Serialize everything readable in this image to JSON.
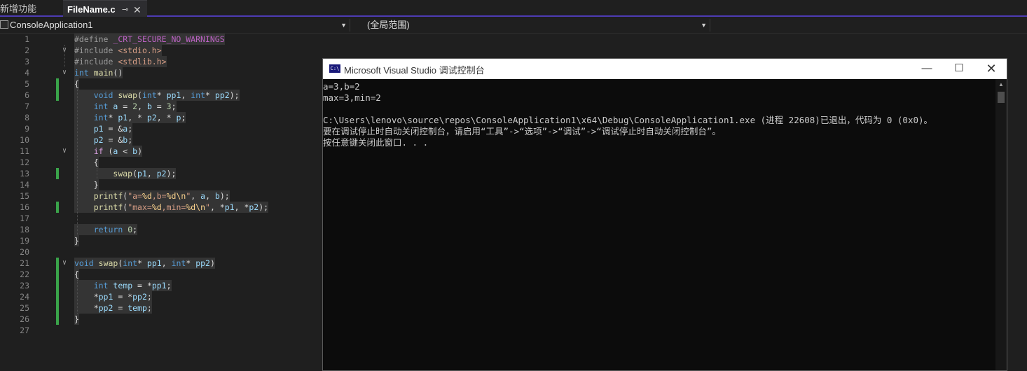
{
  "tabs": [
    {
      "label": "新增功能"
    },
    {
      "label": "FileName.c",
      "pin": "⊸",
      "close": "✕"
    }
  ],
  "navbar": {
    "project": "ConsoleApplication1",
    "scope": "(全局范围)"
  },
  "editor": {
    "line_numbers": [
      "1",
      "2",
      "3",
      "4",
      "5",
      "6",
      "7",
      "8",
      "9",
      "10",
      "11",
      "12",
      "13",
      "14",
      "15",
      "16",
      "17",
      "18",
      "19",
      "20",
      "21",
      "22",
      "23",
      "24",
      "25",
      "26",
      "27"
    ],
    "code": [
      "#define _CRT_SECURE_NO_WARNINGS",
      "#include <stdio.h>",
      "#include <stdlib.h>",
      "int main()",
      "{",
      "    void swap(int* pp1, int* pp2);",
      "    int a = 2, b = 3;",
      "    int* p1, * p2, * p;",
      "    p1 = &a;",
      "    p2 = &b;",
      "    if (a < b)",
      "    {",
      "        swap(p1, p2);",
      "    }",
      "    printf(\"a=%d,b=%d\\n\", a, b);",
      "    printf(\"max=%d,min=%d\\n\", *p1, *p2);",
      "",
      "    return 0;",
      "}",
      "",
      "void swap(int* pp1, int* pp2)",
      "{",
      "    int temp = *pp1;",
      "    *pp1 = *pp2;",
      "    *pp2 = temp;",
      "}",
      ""
    ],
    "fold_markers": {
      "2": "∨",
      "4": "∨",
      "11": "∨",
      "21": "∨"
    }
  },
  "console": {
    "title": "Microsoft Visual Studio 调试控制台",
    "icon_text": "C:\\",
    "buttons": {
      "minimize": "—",
      "maximize": "☐",
      "close": "✕"
    },
    "lines": [
      "a=3,b=2",
      "max=3,min=2",
      "",
      "C:\\Users\\lenovo\\source\\repos\\ConsoleApplication1\\x64\\Debug\\ConsoleApplication1.exe (进程 22608)已退出，代码为 0 (0x0)。",
      "要在调试停止时自动关闭控制台，请启用“工具”->“选项”->“调试”->“调试停止时自动关闭控制台”。",
      "按任意键关闭此窗口. . ."
    ]
  },
  "colors": {
    "accent": "#4d3bb3",
    "change_bar": "#3aa34a",
    "console_bg": "#0c0c0c"
  }
}
